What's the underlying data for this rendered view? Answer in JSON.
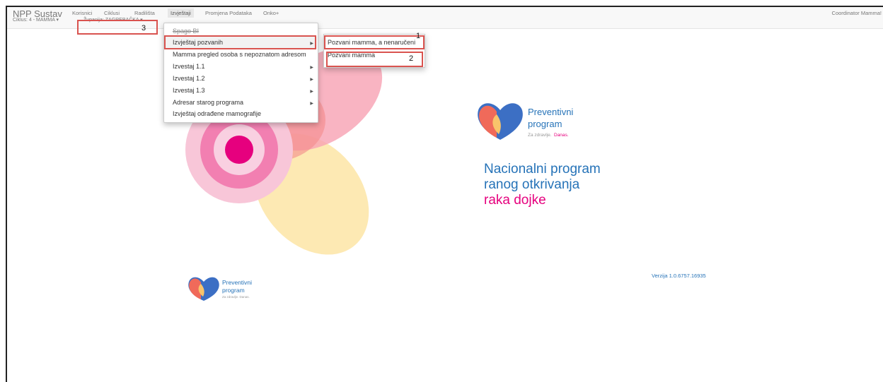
{
  "navbar": {
    "brand": "NPP Sustav",
    "items": [
      "Korisnici",
      "Ciklusi",
      "Radilišta",
      "Izvještaji",
      "Promjena Podataka",
      "Onko+"
    ],
    "user": "Coordinator Mamma!"
  },
  "subnav": {
    "cycle": "Ciklus: 4 - MAMMA ▾",
    "county": "Županija: ZAGREBAČKA ▾"
  },
  "menu": {
    "items": [
      "Spago BI",
      "Izvještaj pozvanih",
      "Mamma pregled osoba s nepoznatom adresom",
      "Izvestaj 1.1",
      "Izvestaj 1.2",
      "Izvestaj 1.3",
      "Adresar starog programa",
      "Izvještaj odrađene mamografije"
    ],
    "submenu": [
      "Pozvani mamma, a nenaručeni",
      "Pozvani mamma"
    ]
  },
  "annotations": [
    "1",
    "2",
    "3"
  ],
  "hero": {
    "logo_title_1": "Preventivni",
    "logo_title_2": "program",
    "tagline_a": "Za zdravlje.",
    "tagline_b": "Danas.",
    "heading_line1": "Nacionalni program",
    "heading_line2": "ranog otkrivanja",
    "heading_line3": "raka dojke"
  },
  "footer": {
    "logo_title_1": "Preventivni",
    "logo_title_2": "program",
    "tagline": "Za zdravlje. Danas.",
    "version": "Verzija 1.0.6757.16935"
  },
  "colors": {
    "pink": "#e6007e",
    "blue": "#2673b8",
    "red_box": "#d9534f"
  }
}
